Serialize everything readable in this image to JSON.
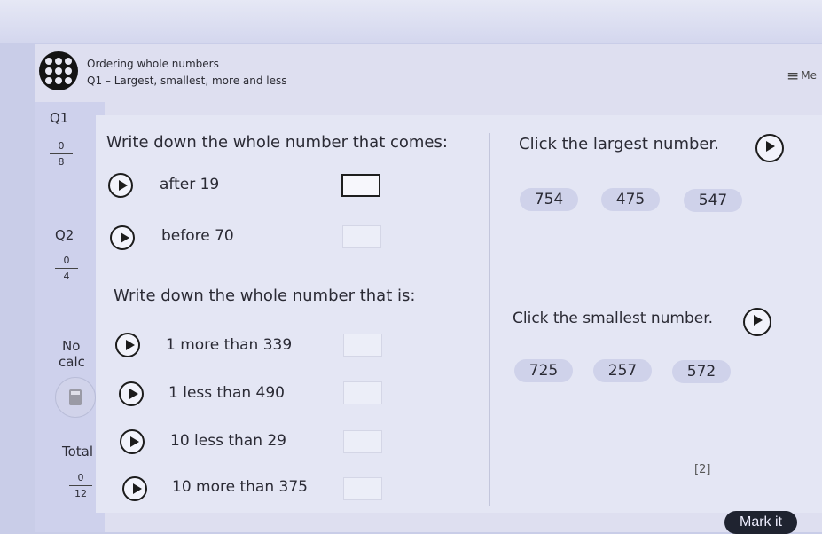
{
  "header": {
    "topic": "Ordering whole numbers",
    "subtitle": "Q1 – Largest, smallest, more and less",
    "menu_label": "Me"
  },
  "sidebar": {
    "q1": {
      "label": "Q1",
      "score": "0",
      "total": "8"
    },
    "q2": {
      "label": "Q2",
      "score": "0",
      "total": "4"
    },
    "calc_note_line1": "No",
    "calc_note_line2": "calc",
    "total": {
      "label": "Total",
      "score": "0",
      "total": "12"
    }
  },
  "left_panel": {
    "instruction_1": "Write down the whole number that comes:",
    "items_1": [
      {
        "label": "after 19",
        "value": ""
      },
      {
        "label": "before 70",
        "value": ""
      }
    ],
    "instruction_2": "Write down the whole number that is:",
    "items_2": [
      {
        "label": "1 more than 339",
        "value": ""
      },
      {
        "label": "1 less than 490",
        "value": ""
      },
      {
        "label": "10 less than 29",
        "value": ""
      },
      {
        "label": "10 more than 375",
        "value": ""
      }
    ]
  },
  "right_panel": {
    "largest_prompt": "Click the largest number.",
    "largest_options": [
      "754",
      "475",
      "547"
    ],
    "smallest_prompt": "Click the smallest number.",
    "smallest_options": [
      "725",
      "257",
      "572"
    ],
    "marks": "[2]"
  },
  "footer": {
    "mark_button": "Mark it"
  },
  "colors": {
    "accent_dark": "#1f2330",
    "pill": "#cfd2ea",
    "background": "#c9cde8"
  },
  "icons": [
    "grid-menu-icon",
    "hamburger-menu-icon",
    "play-audio-icon",
    "calculator-icon"
  ]
}
